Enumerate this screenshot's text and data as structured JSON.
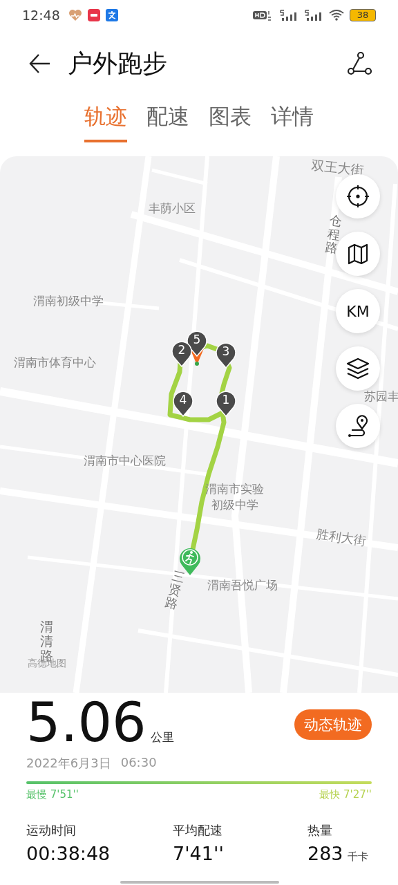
{
  "status_bar": {
    "time": "12:48",
    "battery": "38"
  },
  "header": {
    "title": "户外跑步"
  },
  "tabs": [
    {
      "label": "轨迹",
      "selected": true
    },
    {
      "label": "配速",
      "selected": false
    },
    {
      "label": "图表",
      "selected": false
    },
    {
      "label": "详情",
      "selected": false
    }
  ],
  "map": {
    "labels": [
      {
        "text": "双王大街",
        "kind": "road"
      },
      {
        "text": "丰荫小区",
        "kind": "place"
      },
      {
        "text": "仓程路",
        "kind": "vroad"
      },
      {
        "text": "渭南初级中学",
        "kind": "place"
      },
      {
        "text": "渭南市体育中心",
        "kind": "place"
      },
      {
        "text": "苏园丰",
        "kind": "place"
      },
      {
        "text": "渭南市中心医院",
        "kind": "place"
      },
      {
        "text": "渭南市实验初级中学",
        "kind": "place"
      },
      {
        "text": "胜利大街",
        "kind": "road"
      },
      {
        "text": "三贤路",
        "kind": "vroad"
      },
      {
        "text": "渭南吾悦广场",
        "kind": "place"
      },
      {
        "text": "渭清路",
        "kind": "vroad"
      },
      {
        "text": "高德地图",
        "kind": "credit"
      }
    ],
    "markers": [
      {
        "label": "5"
      },
      {
        "label": "2"
      },
      {
        "label": "3"
      },
      {
        "label": "4"
      },
      {
        "label": "1"
      }
    ],
    "controls": [
      {
        "kind": "locate"
      },
      {
        "kind": "map"
      },
      {
        "kind": "unit",
        "label": "KM"
      },
      {
        "kind": "layers"
      },
      {
        "kind": "route"
      }
    ]
  },
  "summary": {
    "distance": "5.06",
    "unit": "公里",
    "button": "动态轨迹",
    "date": "2022年6月3日",
    "time": "06:30",
    "slowest_label": "最慢 7'51''",
    "fastest_label": "最快 7'27''"
  },
  "stats": [
    {
      "label": "运动时间",
      "value": "00:38:48"
    },
    {
      "label": "平均配速",
      "value": "7'41''"
    },
    {
      "label": "热量",
      "value": "283",
      "unit": "千卡"
    }
  ]
}
